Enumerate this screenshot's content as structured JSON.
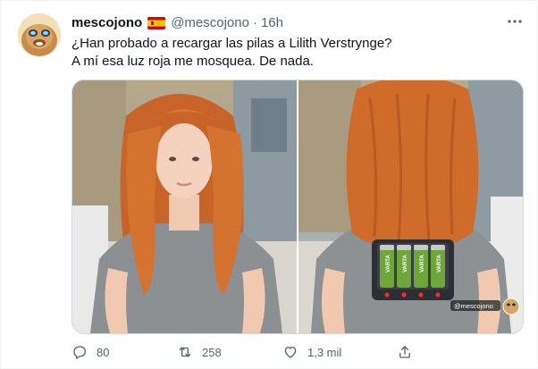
{
  "tweet": {
    "author_name": "mescojono",
    "author_flag": "spain-flag-emoji",
    "author_handle": "@mescojono",
    "separator": "·",
    "time": "16h",
    "text_line1": "¿Han probado a recargar las pilas a Lilith Verstrynge?",
    "text_line2": "A mí esa luz roja me mosquea. De nada.",
    "media_watermark": "@mescojono",
    "battery_labels": [
      "VARTA",
      "VARTA",
      "VARTA",
      "VARTA"
    ]
  },
  "actions": {
    "reply_count": "80",
    "retweet_count": "258",
    "like_count": "1,3 mil"
  },
  "icons": [
    "more-icon",
    "reply-icon",
    "retweet-icon",
    "like-icon",
    "share-icon"
  ],
  "colors": {
    "text_primary": "#0f1419",
    "text_secondary": "#536471",
    "border": "#cfd9de",
    "flag_red": "#c60b1e",
    "flag_yellow": "#ffc400"
  }
}
